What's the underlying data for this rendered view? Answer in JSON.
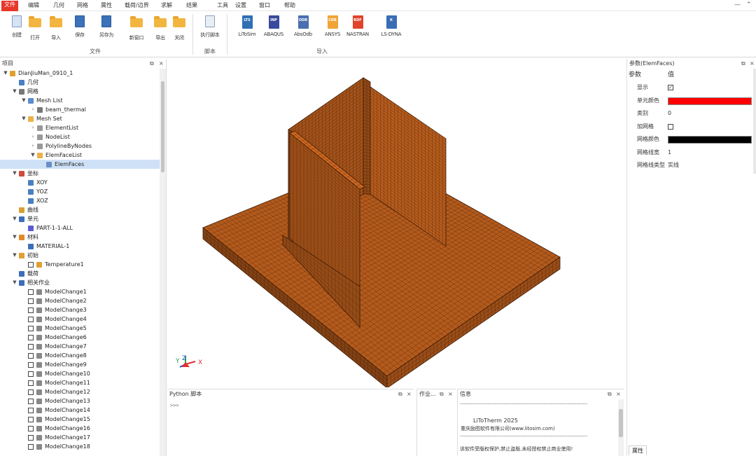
{
  "menu": {
    "items": [
      "文件",
      "编辑",
      "几何",
      "网格",
      "属性",
      "载荷/边界",
      "求解",
      "结果",
      "工具",
      "设置",
      "窗口",
      "帮助"
    ]
  },
  "ribbon": {
    "file_buttons": [
      "创建",
      "打开",
      "导入",
      "保存",
      "另存为",
      "新窗口",
      "导出",
      "关闭"
    ],
    "script_buttons": [
      "执行脚本"
    ],
    "import_buttons": [
      {
        "label": "LiToSim",
        "tag": "LTS",
        "color": "#2f6fb5"
      },
      {
        "label": "ABAQUS",
        "tag": "INP",
        "color": "#3a4a9c"
      },
      {
        "label": "AbsOdb",
        "tag": "ODB",
        "color": "#4a6fb0"
      },
      {
        "label": "ANSYS",
        "tag": "CDB",
        "color": "#f0a436"
      },
      {
        "label": "NASTRAN",
        "tag": "BDF",
        "color": "#e0442c"
      },
      {
        "label": "LS-DYNA",
        "tag": "K",
        "color": "#3a6db5"
      }
    ],
    "groups": [
      "文件",
      "脚本",
      "导入"
    ]
  },
  "left_panel": {
    "title": "项目",
    "tree": [
      {
        "indent": 0,
        "arrow": "▼",
        "icon": "project",
        "label": "DianJiuMan_0910_1"
      },
      {
        "indent": 1,
        "arrow": "",
        "icon": "geometry",
        "label": "几何"
      },
      {
        "indent": 1,
        "arrow": "▼",
        "icon": "mesh",
        "label": "网格"
      },
      {
        "indent": 2,
        "arrow": "▼",
        "icon": "db",
        "label": "Mesh List"
      },
      {
        "indent": 3,
        "arrow": "›",
        "icon": "chart",
        "label": "beam_thermal"
      },
      {
        "indent": 2,
        "arrow": "▼",
        "icon": "folder",
        "label": "Mesh Set"
      },
      {
        "indent": 3,
        "arrow": "›",
        "icon": "list",
        "label": "ElementList"
      },
      {
        "indent": 3,
        "arrow": "›",
        "icon": "list",
        "label": "NodeList"
      },
      {
        "indent": 3,
        "arrow": "›",
        "icon": "list",
        "label": "PolylineByNodes"
      },
      {
        "indent": 3,
        "arrow": "▼",
        "icon": "folder",
        "label": "ElemFaceList"
      },
      {
        "indent": 4,
        "arrow": "",
        "icon": "faces",
        "label": "ElemFaces",
        "selected": true
      },
      {
        "indent": 1,
        "arrow": "▼",
        "icon": "coord",
        "label": "坐标"
      },
      {
        "indent": 2,
        "arrow": "",
        "icon": "plane",
        "label": "XOY"
      },
      {
        "indent": 2,
        "arrow": "",
        "icon": "plane",
        "label": "YOZ"
      },
      {
        "indent": 2,
        "arrow": "",
        "icon": "plane",
        "label": "XOZ"
      },
      {
        "indent": 1,
        "arrow": "",
        "icon": "curve",
        "label": "曲线"
      },
      {
        "indent": 1,
        "arrow": "▼",
        "icon": "unit",
        "label": "单元"
      },
      {
        "indent": 2,
        "arrow": "",
        "icon": "part",
        "label": "PART-1-1-ALL"
      },
      {
        "indent": 1,
        "arrow": "▼",
        "icon": "material",
        "label": "材料"
      },
      {
        "indent": 2,
        "arrow": "",
        "icon": "matitem",
        "label": "MATERIAL-1"
      },
      {
        "indent": 1,
        "arrow": "▼",
        "icon": "init",
        "label": "初始"
      },
      {
        "indent": 2,
        "arrow": "",
        "icon": "temp",
        "label": "Temperature1",
        "checkbox": true
      },
      {
        "indent": 1,
        "arrow": "",
        "icon": "load",
        "label": "载荷"
      },
      {
        "indent": 1,
        "arrow": "▼",
        "icon": "load",
        "label": "相关作业"
      },
      {
        "indent": 2,
        "arrow": "",
        "icon": "mc",
        "label": "ModelChange1",
        "checkbox": true
      },
      {
        "indent": 2,
        "arrow": "",
        "icon": "mc",
        "label": "ModelChange2",
        "checkbox": true
      },
      {
        "indent": 2,
        "arrow": "",
        "icon": "mc",
        "label": "ModelChange3",
        "checkbox": true
      },
      {
        "indent": 2,
        "arrow": "",
        "icon": "mc",
        "label": "ModelChange4",
        "checkbox": true
      },
      {
        "indent": 2,
        "arrow": "",
        "icon": "mc",
        "label": "ModelChange5",
        "checkbox": true
      },
      {
        "indent": 2,
        "arrow": "",
        "icon": "mc",
        "label": "ModelChange6",
        "checkbox": true
      },
      {
        "indent": 2,
        "arrow": "",
        "icon": "mc",
        "label": "ModelChange7",
        "checkbox": true
      },
      {
        "indent": 2,
        "arrow": "",
        "icon": "mc",
        "label": "ModelChange8",
        "checkbox": true
      },
      {
        "indent": 2,
        "arrow": "",
        "icon": "mc",
        "label": "ModelChange9",
        "checkbox": true
      },
      {
        "indent": 2,
        "arrow": "",
        "icon": "mc",
        "label": "ModelChange10",
        "checkbox": true
      },
      {
        "indent": 2,
        "arrow": "",
        "icon": "mc",
        "label": "ModelChange11",
        "checkbox": true
      },
      {
        "indent": 2,
        "arrow": "",
        "icon": "mc",
        "label": "ModelChange12",
        "checkbox": true
      },
      {
        "indent": 2,
        "arrow": "",
        "icon": "mc",
        "label": "ModelChange13",
        "checkbox": true
      },
      {
        "indent": 2,
        "arrow": "",
        "icon": "mc",
        "label": "ModelChange14",
        "checkbox": true
      },
      {
        "indent": 2,
        "arrow": "",
        "icon": "mc",
        "label": "ModelChange15",
        "checkbox": true
      },
      {
        "indent": 2,
        "arrow": "",
        "icon": "mc",
        "label": "ModelChange16",
        "checkbox": true
      },
      {
        "indent": 2,
        "arrow": "",
        "icon": "mc",
        "label": "ModelChange17",
        "checkbox": true
      },
      {
        "indent": 2,
        "arrow": "",
        "icon": "mc",
        "label": "ModelChange18",
        "checkbox": true
      }
    ]
  },
  "viewport": {
    "mesh_color": "#b35a1c",
    "axis": {
      "x": "X",
      "y": "Y",
      "z": "Z"
    }
  },
  "python": {
    "title": "Python 脚本",
    "prompt": ">>> "
  },
  "attr_panel": {
    "title": "作业..."
  },
  "output": {
    "title": "信息",
    "divider": "------------------------------------------------------------------------------------",
    "app": "LiToTherm 2025",
    "company": "重庆励图软件有限公司(www.litosim.com)",
    "notice": "该软件受版权保护,禁止盗版,未经授权禁止商业使用!"
  },
  "right_panel": {
    "title": "参数(ElemFaces)",
    "header_key": "参数",
    "header_val": "值",
    "rows": [
      {
        "key": "显示",
        "type": "check",
        "checked": true
      },
      {
        "key": "单元颜色",
        "type": "color",
        "color": "#ff0000"
      },
      {
        "key": "类别",
        "type": "text",
        "value": "0"
      },
      {
        "key": "加网格",
        "type": "check",
        "checked": false
      },
      {
        "key": "网格颜色",
        "type": "color",
        "color": "#000000"
      },
      {
        "key": "网格线宽",
        "type": "text",
        "value": "1"
      },
      {
        "key": "网格线类型",
        "type": "text",
        "value": "实线"
      }
    ],
    "bottom_tab": "属性"
  }
}
